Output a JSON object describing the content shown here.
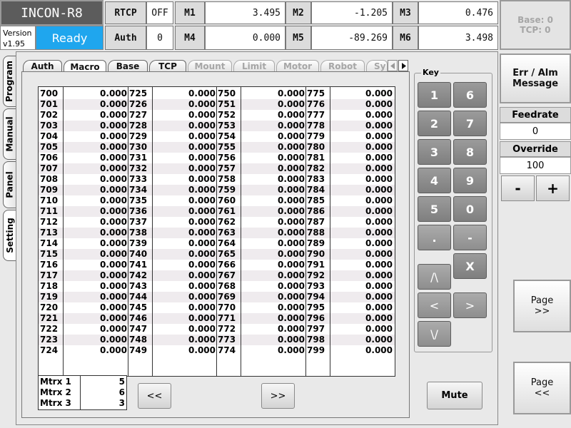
{
  "app": {
    "title": "INCON-R8",
    "version_label": "Version",
    "version": "v1.95",
    "status": "Ready"
  },
  "header": {
    "rtcp": {
      "label": "RTCP",
      "value": "OFF"
    },
    "auth": {
      "label": "Auth",
      "value": "0"
    },
    "m": [
      {
        "label": "M1",
        "value": "3.495"
      },
      {
        "label": "M2",
        "value": "-1.205"
      },
      {
        "label": "M3",
        "value": "0.476"
      },
      {
        "label": "M4",
        "value": "0.000"
      },
      {
        "label": "M5",
        "value": "-89.269"
      },
      {
        "label": "M6",
        "value": "3.498"
      }
    ],
    "base_tcp": "Base: 0\nTCP: 0"
  },
  "side_tabs": [
    "Program",
    "Manual",
    "Panel",
    "Setting"
  ],
  "tabs": [
    {
      "label": "Auth",
      "state": "normal"
    },
    {
      "label": "Macro",
      "state": "active"
    },
    {
      "label": "Base",
      "state": "normal"
    },
    {
      "label": "TCP",
      "state": "normal"
    },
    {
      "label": "Mount",
      "state": "disabled"
    },
    {
      "label": "Limit",
      "state": "disabled"
    },
    {
      "label": "Motor",
      "state": "disabled"
    },
    {
      "label": "Robot",
      "state": "disabled"
    },
    {
      "label": "Sy",
      "state": "disabled"
    }
  ],
  "macro": {
    "columns": [
      {
        "start": 700,
        "values": [
          "0.000",
          "0.000",
          "0.000",
          "0.000",
          "0.000",
          "0.000",
          "0.000",
          "0.000",
          "0.000",
          "0.000",
          "0.000",
          "0.000",
          "0.000",
          "0.000",
          "0.000",
          "0.000",
          "0.000",
          "0.000",
          "0.000",
          "0.000",
          "0.000",
          "0.000",
          "0.000",
          "0.000",
          "0.000"
        ]
      },
      {
        "start": 725,
        "values": [
          "0.000",
          "0.000",
          "0.000",
          "0.000",
          "0.000",
          "0.000",
          "0.000",
          "0.000",
          "0.000",
          "0.000",
          "0.000",
          "0.000",
          "0.000",
          "0.000",
          "0.000",
          "0.000",
          "0.000",
          "0.000",
          "0.000",
          "0.000",
          "0.000",
          "0.000",
          "0.000",
          "0.000",
          "0.000"
        ]
      },
      {
        "start": 750,
        "values": [
          "0.000",
          "0.000",
          "0.000",
          "0.000",
          "0.000",
          "0.000",
          "0.000",
          "0.000",
          "0.000",
          "0.000",
          "0.000",
          "0.000",
          "0.000",
          "0.000",
          "0.000",
          "0.000",
          "0.000",
          "0.000",
          "0.000",
          "0.000",
          "0.000",
          "0.000",
          "0.000",
          "0.000",
          "0.000"
        ]
      },
      {
        "start": 775,
        "values": [
          "0.000",
          "0.000",
          "0.000",
          "0.000",
          "0.000",
          "0.000",
          "0.000",
          "0.000",
          "0.000",
          "0.000",
          "0.000",
          "0.000",
          "0.000",
          "0.000",
          "0.000",
          "0.000",
          "0.000",
          "0.000",
          "0.000",
          "0.000",
          "0.000",
          "0.000",
          "0.000",
          "0.000",
          "0.000"
        ]
      }
    ],
    "matrix": [
      {
        "label": "Mtrx 1",
        "value": "5"
      },
      {
        "label": "Mtrx 2",
        "value": "6"
      },
      {
        "label": "Mtrx 3",
        "value": "3"
      }
    ],
    "prev_label": "<<",
    "next_label": ">>"
  },
  "keypad": {
    "title": "Key",
    "digits": [
      "1",
      "6",
      "2",
      "7",
      "3",
      "8",
      "4",
      "9",
      "5",
      "0",
      ".",
      "-"
    ],
    "x_label": "X",
    "up_label": "/\\",
    "down_label": "\\/",
    "left_label": "<",
    "right_label": ">",
    "mute_label": "Mute"
  },
  "right": {
    "err_label": "Err / Alm\nMessage",
    "feedrate_label": "Feedrate",
    "feedrate_value": "0",
    "override_label": "Override",
    "override_value": "100",
    "minus_label": "-",
    "plus_label": "+",
    "page_next": "Page\n>>",
    "page_prev": "Page\n<<"
  },
  "colors": {
    "status_bg": "#1fa6ee",
    "title_bg": "#5c5c5c",
    "key_bg": "#8c8c8c"
  }
}
